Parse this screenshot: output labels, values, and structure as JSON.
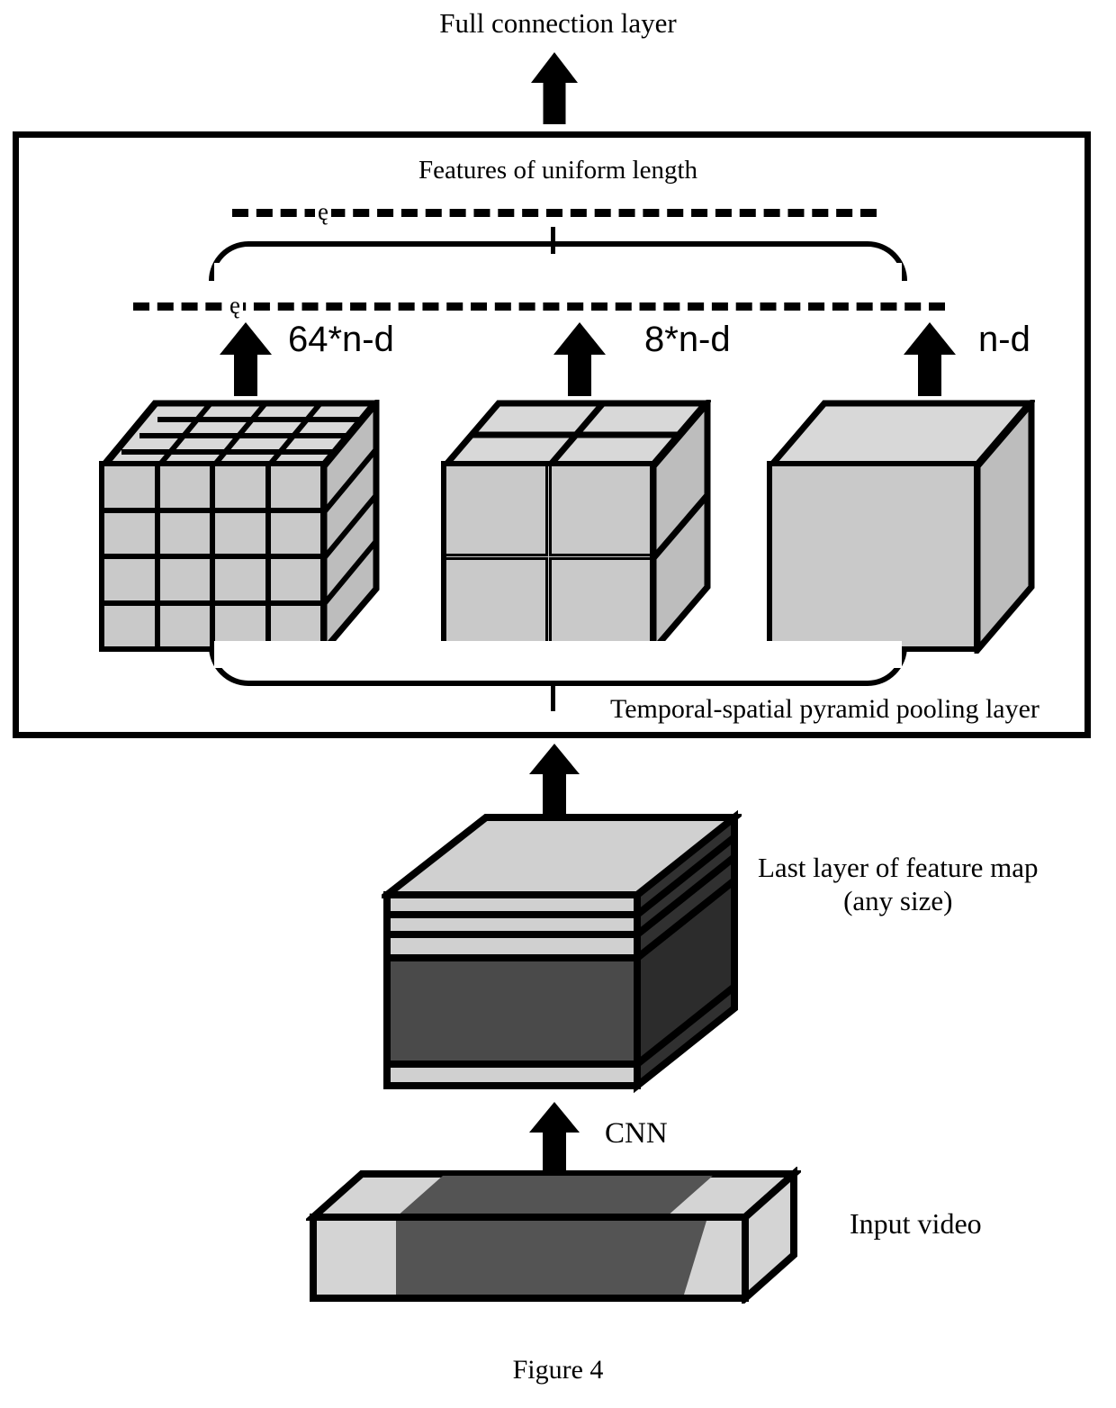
{
  "figure": {
    "caption": "Figure 4",
    "top_label": "Full connection layer",
    "features_label": "Features of uniform length",
    "pooling_layer_label": "Temporal-spatial pyramid pooling layer",
    "feature_map_label_line1": "Last layer of feature map",
    "feature_map_label_line2": "(any size)",
    "cnn_label": "CNN",
    "input_video_label": "Input video",
    "rail_glyph": "ę"
  },
  "pyramid_levels": [
    {
      "label": "64*n-d",
      "divisions": 4,
      "cells": 64,
      "name": "level-64"
    },
    {
      "label": "8*n-d",
      "divisions": 2,
      "cells": 8,
      "name": "level-8"
    },
    {
      "label": "n-d",
      "divisions": 1,
      "cells": 1,
      "name": "level-1"
    }
  ],
  "colors": {
    "ink": "#000000",
    "background": "#ffffff",
    "cube_face": "#c9c9c9",
    "cube_top": "#d8d8d8",
    "cube_side": "#bdbdbd",
    "featuremap_top": "#d0d0d0",
    "featuremap_body": "#4a4a4a",
    "video_light": "#d4d4d4",
    "video_dark": "#545454"
  }
}
